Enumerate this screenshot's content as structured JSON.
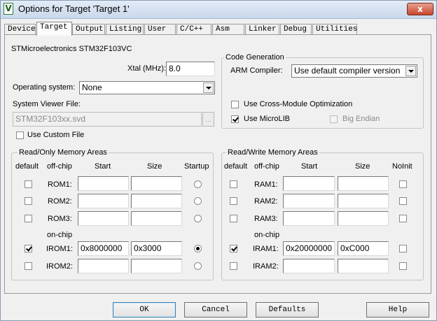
{
  "window": {
    "title": "Options for Target 'Target 1'",
    "close_glyph": "x",
    "icon_glyph": "V"
  },
  "tabs": [
    "Device",
    "Target",
    "Output",
    "Listing",
    "User",
    "C/C++",
    "Asm",
    "Linker",
    "Debug",
    "Utilities"
  ],
  "active_tab": "Target",
  "device": "STMicroelectronics STM32F103VC",
  "xtal": {
    "label": "Xtal (MHz):",
    "value": "8.0"
  },
  "os": {
    "label": "Operating system:",
    "value": "None"
  },
  "svd": {
    "label": "System Viewer File:",
    "value": "STM32F103xx.svd",
    "browse": "..."
  },
  "custom_file": {
    "label": "Use Custom File",
    "checked": false
  },
  "codegen": {
    "title": "Code Generation",
    "compiler_label": "ARM Compiler:",
    "compiler_value": "Use default compiler version",
    "cross_module": {
      "label": "Use Cross-Module Optimization",
      "checked": false
    },
    "microlib": {
      "label": "Use MicroLIB",
      "checked": true
    },
    "big_endian": {
      "label": "Big Endian",
      "checked": false
    }
  },
  "ro_mem": {
    "title": "Read/Only Memory Areas",
    "headers": {
      "default": "default",
      "offchip": "off-chip",
      "start": "Start",
      "size": "Size",
      "startup": "Startup"
    },
    "onchip_label": "on-chip",
    "rows": [
      {
        "name": "ROM1:",
        "start": "",
        "size": ""
      },
      {
        "name": "ROM2:",
        "start": "",
        "size": ""
      },
      {
        "name": "ROM3:",
        "start": "",
        "size": ""
      },
      {
        "name": "IROM1:",
        "start": "0x8000000",
        "size": "0x3000"
      },
      {
        "name": "IROM2:",
        "start": "",
        "size": ""
      }
    ]
  },
  "rw_mem": {
    "title": "Read/Write Memory Areas",
    "headers": {
      "default": "default",
      "offchip": "off-chip",
      "start": "Start",
      "size": "Size",
      "noinit": "NoInit"
    },
    "onchip_label": "on-chip",
    "rows": [
      {
        "name": "RAM1:",
        "start": "",
        "size": ""
      },
      {
        "name": "RAM2:",
        "start": "",
        "size": ""
      },
      {
        "name": "RAM3:",
        "start": "",
        "size": ""
      },
      {
        "name": "IRAM1:",
        "start": "0x20000000",
        "size": "0xC000"
      },
      {
        "name": "IRAM2:",
        "start": "",
        "size": ""
      }
    ]
  },
  "buttons": {
    "ok": "OK",
    "cancel": "Cancel",
    "defaults": "Defaults",
    "help": "Help"
  }
}
